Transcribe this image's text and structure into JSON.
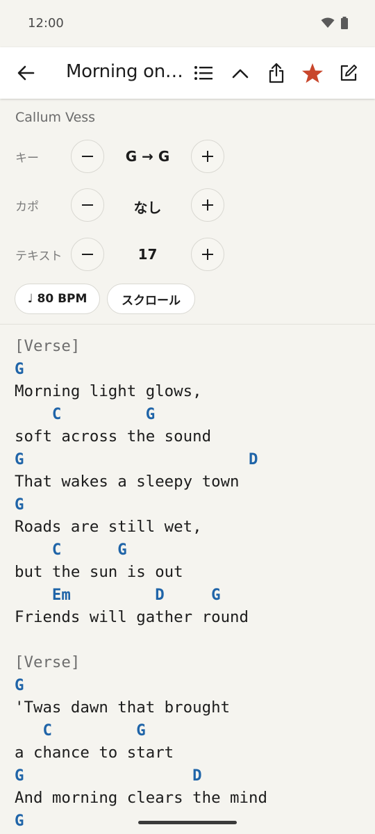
{
  "status": {
    "time": "12:00"
  },
  "toolbar": {
    "title": "Morning on t...",
    "title_full": "Morning on t...",
    "icons": [
      "back-arrow-icon",
      "list-icon",
      "chevron-up-icon",
      "share-icon",
      "star-icon",
      "edit-icon"
    ],
    "star_color": "#c8462b"
  },
  "song": {
    "artist": "Callum Vess"
  },
  "controls": {
    "key": {
      "label": "キー",
      "value": "G → G"
    },
    "capo": {
      "label": "カポ",
      "value": "なし"
    },
    "text": {
      "label": "テキスト",
      "value": "17"
    }
  },
  "chips": {
    "bpm": "♩ 80 BPM",
    "scroll": "スクロール"
  },
  "colors": {
    "chord": "#1f64a8",
    "background": "#f5f4ef"
  },
  "sheet": {
    "lines": [
      {
        "type": "section",
        "text": "[Verse]"
      },
      {
        "type": "chords",
        "text": "G"
      },
      {
        "type": "lyric",
        "text": "Morning light glows,"
      },
      {
        "type": "chords",
        "text": "    C         G"
      },
      {
        "type": "lyric",
        "text": "soft across the sound"
      },
      {
        "type": "chords",
        "text": "G                        D"
      },
      {
        "type": "lyric",
        "text": "That wakes a sleepy town"
      },
      {
        "type": "chords",
        "text": "G"
      },
      {
        "type": "lyric",
        "text": "Roads are still wet,"
      },
      {
        "type": "chords",
        "text": "    C      G"
      },
      {
        "type": "lyric",
        "text": "but the sun is out"
      },
      {
        "type": "chords",
        "text": "    Em         D     G"
      },
      {
        "type": "lyric",
        "text": "Friends will gather round"
      },
      {
        "type": "blank",
        "text": ""
      },
      {
        "type": "section",
        "text": "[Verse]"
      },
      {
        "type": "chords",
        "text": "G"
      },
      {
        "type": "lyric",
        "text": "'Twas dawn that brought"
      },
      {
        "type": "chords",
        "text": "   C         G"
      },
      {
        "type": "lyric",
        "text": "a chance to start"
      },
      {
        "type": "chords",
        "text": "G                  D"
      },
      {
        "type": "lyric",
        "text": "And morning clears the mind"
      },
      {
        "type": "chords",
        "text": "G"
      }
    ]
  }
}
